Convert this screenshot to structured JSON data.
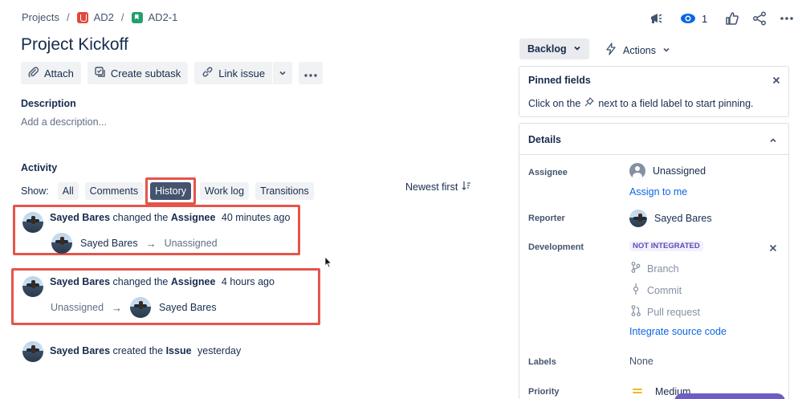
{
  "breadcrumb": {
    "projects": "Projects",
    "project": "AD2",
    "issue": "AD2-1"
  },
  "topbar": {
    "watch_count": "1"
  },
  "issue": {
    "title": "Project Kickoff"
  },
  "toolbar": {
    "attach": "Attach",
    "create_subtask": "Create subtask",
    "link_issue": "Link issue"
  },
  "description": {
    "label": "Description",
    "placeholder": "Add a description..."
  },
  "activity": {
    "label": "Activity",
    "show_label": "Show:",
    "filters": [
      "All",
      "Comments",
      "History",
      "Work log",
      "Transitions"
    ],
    "active_filter": "History",
    "sort_label": "Newest first",
    "entries": [
      {
        "user": "Sayed Bares",
        "verb": "changed the",
        "field": "Assignee",
        "time": "40 minutes ago",
        "from": "Sayed Bares",
        "to": "Unassigned"
      },
      {
        "user": "Sayed Bares",
        "verb": "changed the",
        "field": "Assignee",
        "time": "4 hours ago",
        "from": "Unassigned",
        "to": "Sayed Bares"
      },
      {
        "user": "Sayed Bares",
        "verb": "created the",
        "field": "Issue",
        "time": "yesterday"
      }
    ]
  },
  "sidebar": {
    "status": "Backlog",
    "actions": "Actions",
    "pinned": {
      "title": "Pinned fields",
      "hint_before": "Click on the",
      "hint_after": "next to a field label to start pinning."
    },
    "details": {
      "title": "Details",
      "assignee_label": "Assignee",
      "assignee_value": "Unassigned",
      "assign_to_me": "Assign to me",
      "reporter_label": "Reporter",
      "reporter_value": "Sayed Bares",
      "development_label": "Development",
      "development_badge": "NOT INTEGRATED",
      "dev_items": [
        "Branch",
        "Commit",
        "Pull request"
      ],
      "integrate_link": "Integrate source code",
      "labels_label": "Labels",
      "labels_value": "None",
      "priority_label": "Priority",
      "priority_value": "Medium"
    }
  },
  "colors": {
    "highlight": "#e5544c",
    "link": "#0c66e4",
    "priority": "#e2b203"
  }
}
